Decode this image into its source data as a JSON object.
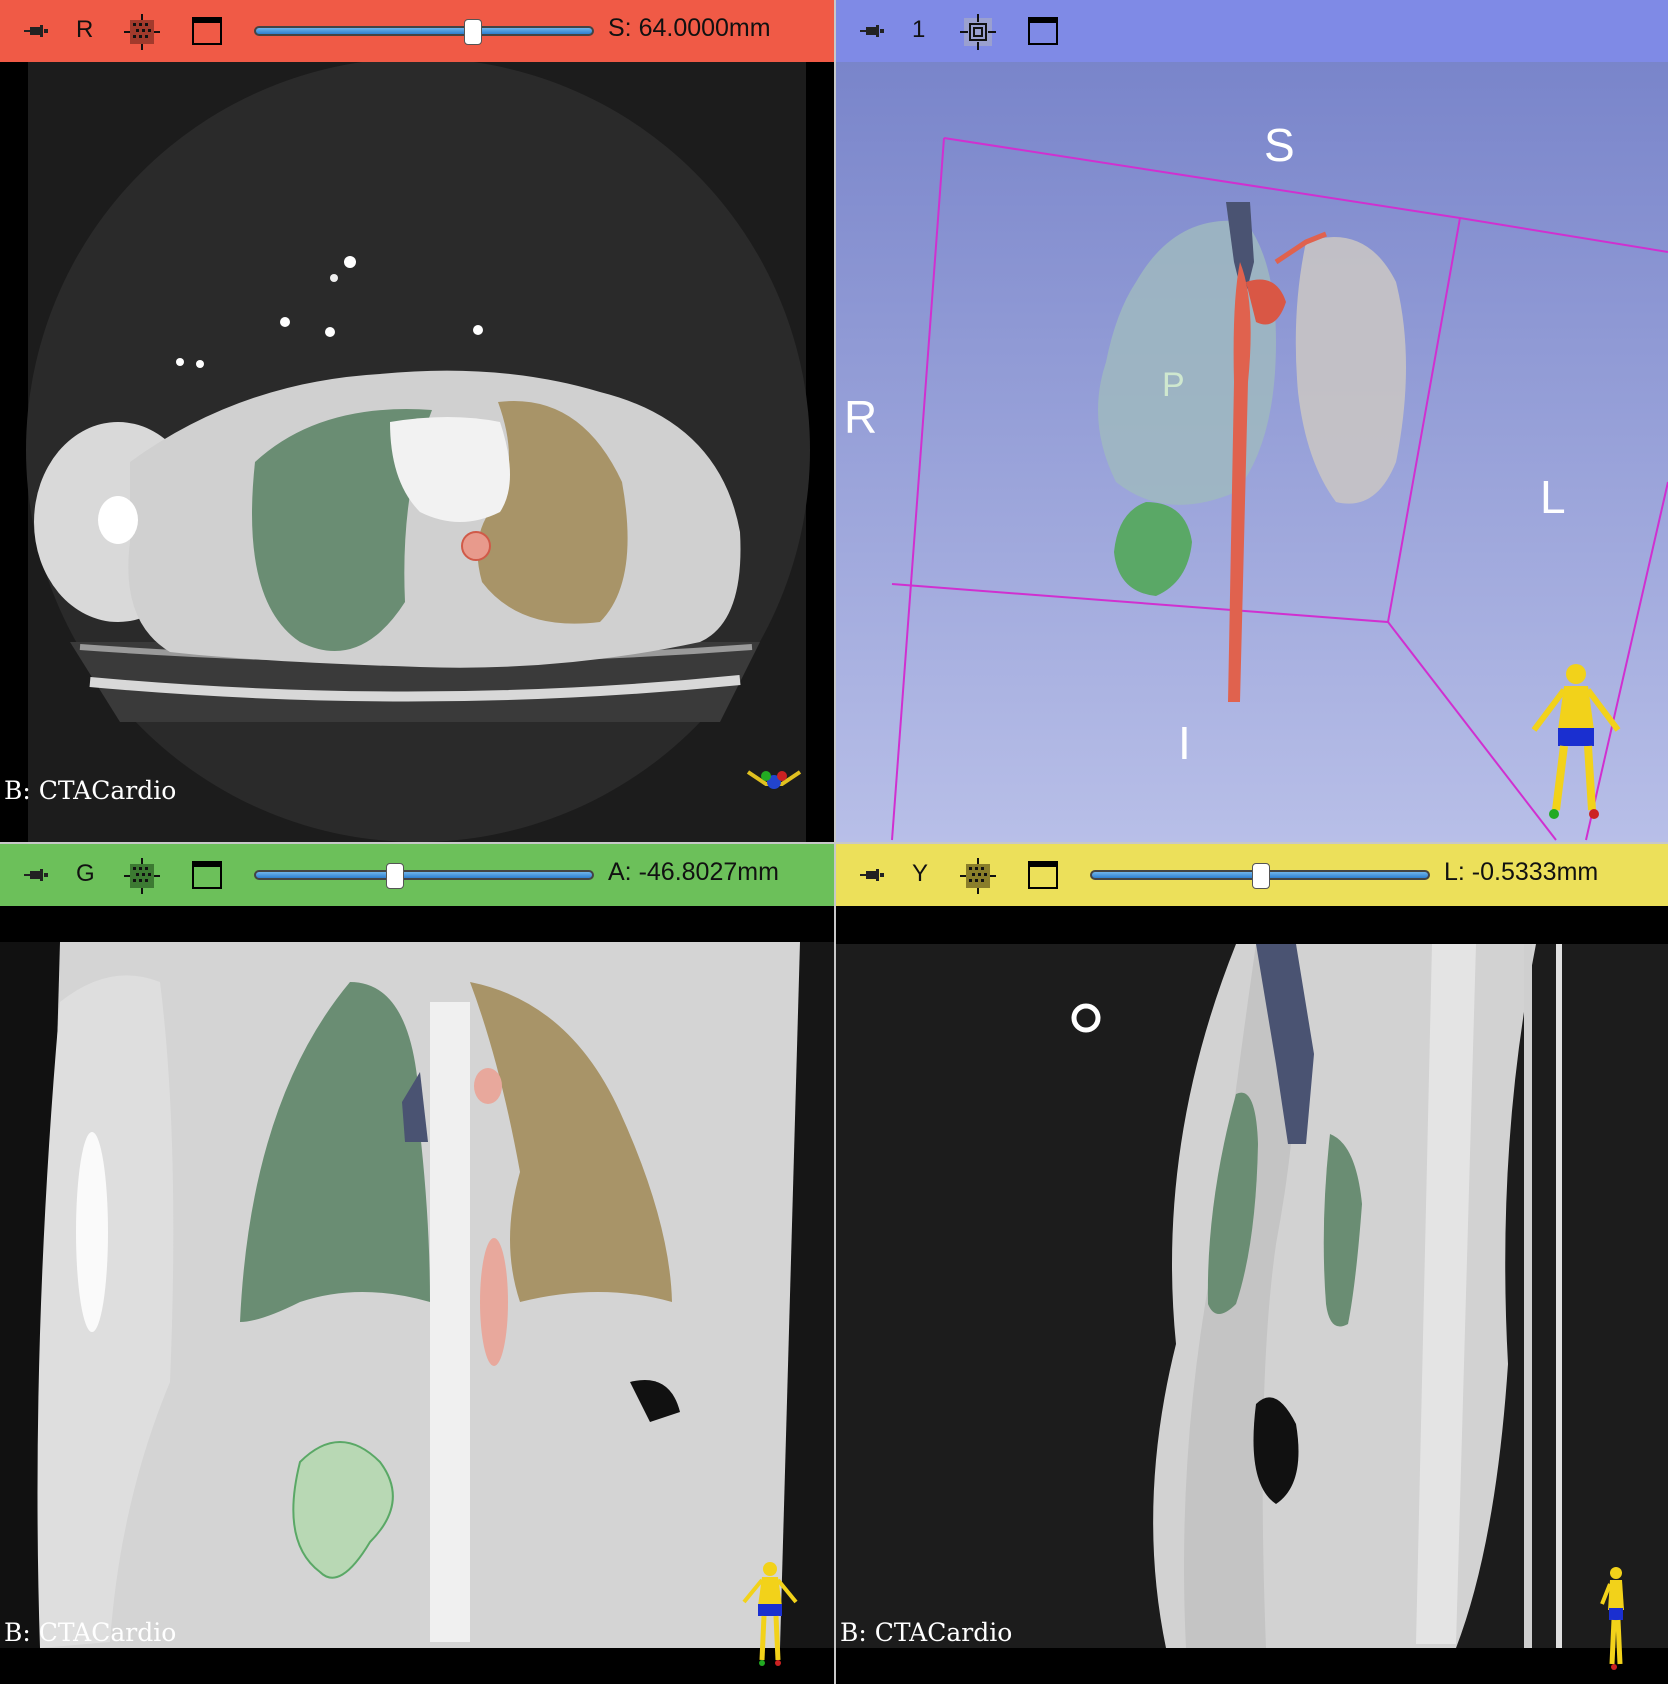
{
  "views": {
    "red": {
      "label": "R",
      "offset": "S: 64.0000mm",
      "background": "B: CTACardio",
      "bar_color": "#f05a46",
      "slider_fraction": 0.62
    },
    "three_d": {
      "label": "1",
      "bar_color": "#7f8ae6",
      "orientation": {
        "superior": "S",
        "inferior": "I",
        "right": "R",
        "left": "L",
        "landmark": "P"
      }
    },
    "green": {
      "label": "G",
      "offset": "A: -46.8027mm",
      "background": "B: CTACardio",
      "bar_color": "#6cc05a",
      "slider_fraction": 0.39
    },
    "yellow": {
      "label": "Y",
      "offset": "L: -0.5333mm",
      "background": "B: CTACardio",
      "bar_color": "#ece05a",
      "slider_fraction": 0.47
    }
  },
  "colors": {
    "right_lung": "#5f9a6e",
    "left_lung": "#c2a56a",
    "aorta": "#e0624e",
    "vena_cava": "#4a5372",
    "kidney": "#5aa866"
  },
  "icons": [
    "pin-icon",
    "slice-controls-icon",
    "view-controls-icon",
    "maximize-view-icon",
    "orientation-marker-icon"
  ]
}
